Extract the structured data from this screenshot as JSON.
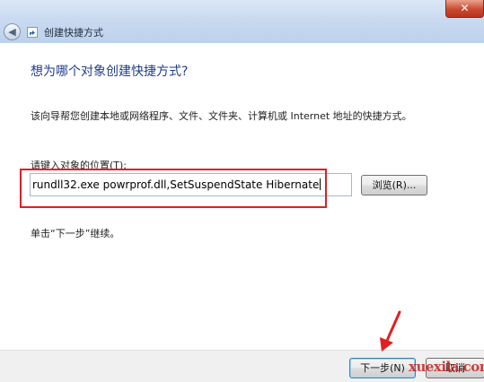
{
  "window": {
    "title": "创建快捷方式",
    "back_icon": "back-arrow-icon",
    "close_glyph": "✕"
  },
  "main": {
    "heading": "想为哪个对象创建快捷方式?",
    "description": "该向导帮您创建本地或网络程序、文件、文件夹、计算机或 Internet 地址的快捷方式。",
    "field_label": "请键入对象的位置(T):",
    "location_value": "rundll32.exe powrprof.dll,SetSuspendState Hibernate",
    "browse_label": "浏览(R)...",
    "hint": "单击“下一步”继续。"
  },
  "footer": {
    "next_label": "下一步(N)",
    "cancel_label": "取消"
  },
  "watermark": "xuexila.com",
  "colors": {
    "heading": "#1e3e8c",
    "annotation": "#e02020"
  }
}
